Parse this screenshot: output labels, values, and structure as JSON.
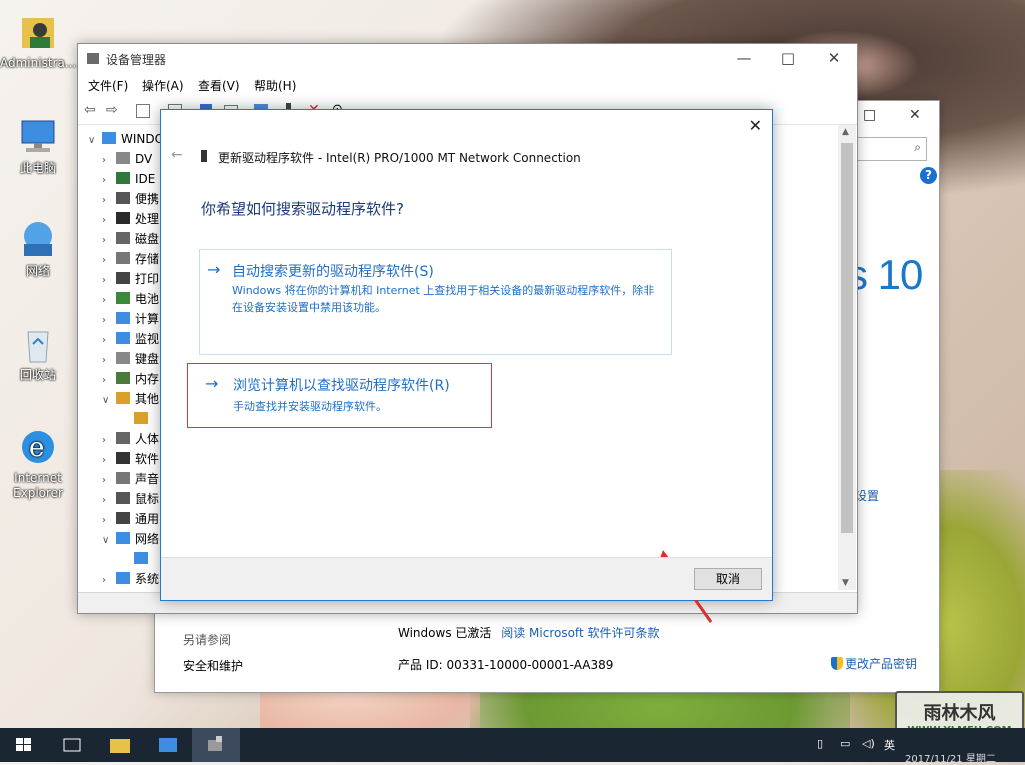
{
  "desktop": {
    "icons": [
      {
        "label": "Administra..."
      },
      {
        "label": "此电脑"
      },
      {
        "label": "网络"
      },
      {
        "label": "回收站"
      },
      {
        "label": "Internet Explorer"
      }
    ]
  },
  "system_window": {
    "logo_text": "s 10",
    "side_link": "设置",
    "see_also": "另请参阅",
    "security": "安全和维护",
    "activation": "Windows 已激活",
    "license_link": "阅读 Microsoft 软件许可条款",
    "product_id": "产品 ID: 00331-10000-00001-AA389",
    "change_key": "更改产品密钥"
  },
  "device_manager": {
    "title": "设备管理器",
    "menu": [
      "文件(F)",
      "操作(A)",
      "查看(V)",
      "帮助(H)"
    ],
    "tree": {
      "root": "WINDO",
      "items": [
        "DV",
        "IDE",
        "便携",
        "处理",
        "磁盘",
        "存储",
        "打印",
        "电池",
        "计算",
        "监视",
        "键盘",
        "内存",
        "其他",
        "",
        "人体",
        "软件",
        "声音",
        "鼠标",
        "通用",
        "网络",
        "",
        "系统"
      ]
    }
  },
  "update_driver": {
    "header": "更新驱动程序软件 - Intel(R) PRO/1000 MT Network Connection",
    "question": "你希望如何搜索驱动程序软件?",
    "option_auto": {
      "title": "自动搜索更新的驱动程序软件(S)",
      "desc": "Windows 将在你的计算机和 Internet 上查找用于相关设备的最新驱动程序软件，除非在设备安装设置中禁用该功能。"
    },
    "option_browse": {
      "title": "浏览计算机以查找驱动程序软件(R)",
      "desc": "手动查找并安装驱动程序软件。"
    },
    "cancel": "取消"
  },
  "taskbar": {
    "clock": "2017/11/21 星期二"
  },
  "watermark": {
    "line1": "雨林木风",
    "line2": "WWW.YLMFU.COM"
  },
  "colors": {
    "accent": "#1f6fc8",
    "highlight_box": "#d23b3b",
    "taskbar": "#1b2633"
  }
}
